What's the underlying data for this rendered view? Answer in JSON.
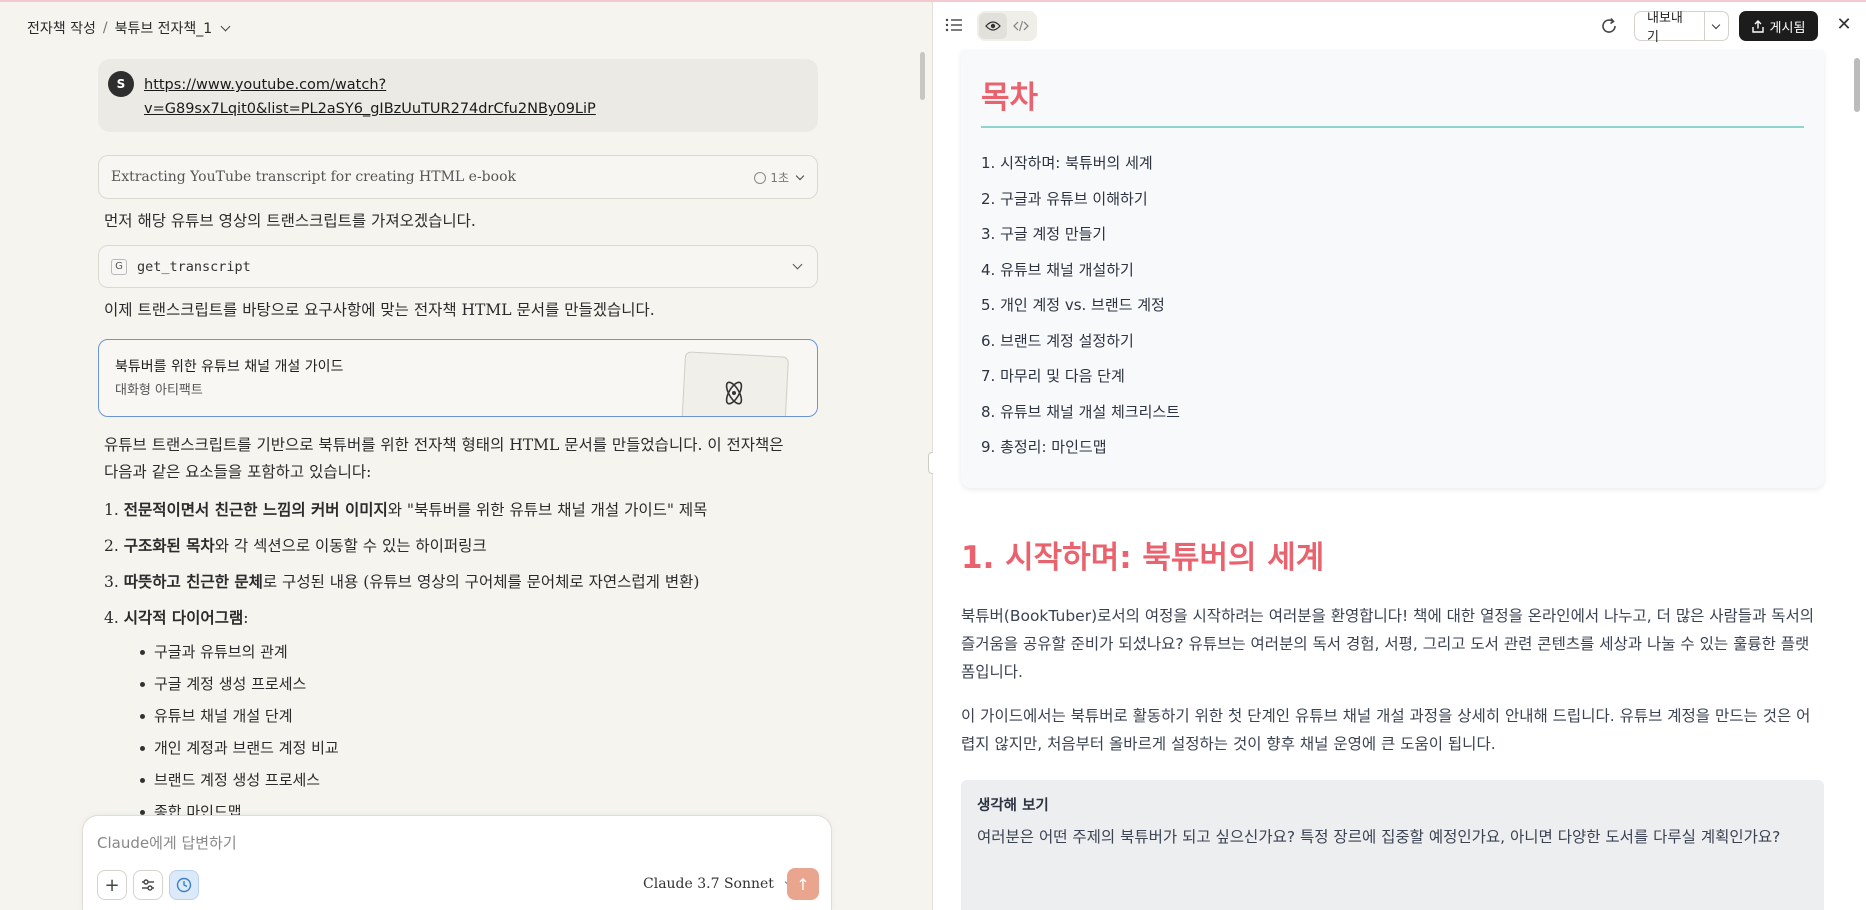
{
  "breadcrumb": {
    "project": "전자책 작성",
    "separator": "/",
    "chat": "북튜브 전자책_1"
  },
  "user_message": {
    "avatar": "S",
    "link_line1": "https://www.youtube.com/watch?",
    "link_line2": "v=G89sx7Lqit0&list=PL2aSY6_gIBzUuTUR274drCfu2NBy09LiP"
  },
  "thinking": {
    "text": "Extracting YouTube transcript for creating HTML e-book",
    "duration": "1초"
  },
  "assistant": {
    "para1": "먼저 해당 유튜브 영상의 트랜스크립트를 가져오겠습니다.",
    "tool_name": "get_transcript",
    "tool_icon": "G",
    "para2": "이제 트랜스크립트를 바탕으로 요구사항에 맞는 전자책 HTML 문서를 만들겠습니다.",
    "artifact_title": "북튜버를 위한 유튜브 채널 개설 가이드",
    "artifact_type": "대화형 아티팩트",
    "summary": "유튜브 트랜스크립트를 기반으로 북튜버를 위한 전자책 형태의 HTML 문서를 만들었습니다. 이 전자책은 다음과 같은 요소들을 포함하고 있습니다:",
    "items": [
      {
        "num": "1.",
        "bold": "전문적이면서 친근한 느낌의 커버 이미지",
        "rest": "와 \"북튜버를 위한 유튜브 채널 개설 가이드\" 제목"
      },
      {
        "num": "2.",
        "bold": "구조화된 목차",
        "rest": "와 각 섹션으로 이동할 수 있는 하이퍼링크"
      },
      {
        "num": "3.",
        "bold": "따뜻하고 친근한 문체",
        "rest": "로 구성된 내용 (유튜브 영상의 구어체를 문어체로 자연스럽게 변환)"
      },
      {
        "num": "4.",
        "bold": "시각적 다이어그램",
        "rest": ":"
      }
    ],
    "subitems": [
      "구글과 유튜브의 관계",
      "구글 계정 생성 프로세스",
      "유튜브 채널 개설 단계",
      "개인 계정과 브랜드 계정 비교",
      "브랜드 계정 생성 프로세스",
      "종합 마인드맵"
    ]
  },
  "composer": {
    "placeholder": "Claude에게 답변하기",
    "model": "Claude 3.7 Sonnet",
    "plus": "+",
    "send": "↑"
  },
  "toolbar": {
    "export_label": "내보내기",
    "publish_label": "게시됨",
    "close": "✕"
  },
  "doc": {
    "toc_title": "목차",
    "toc": [
      "1. 시작하며: 북튜버의 세계",
      "2. 구글과 유튜브 이해하기",
      "3. 구글 계정 만들기",
      "4. 유튜브 채널 개설하기",
      "5. 개인 계정 vs. 브랜드 계정",
      "6. 브랜드 계정 설정하기",
      "7. 마무리 및 다음 단계",
      "8. 유튜브 채널 개설 체크리스트",
      "9. 총정리: 마인드맵"
    ],
    "section1_title": "1. 시작하며: 북튜버의 세계",
    "section1_p1": "북튜버(BookTuber)로서의 여정을 시작하려는 여러분을 환영합니다! 책에 대한 열정을 온라인에서 나누고, 더 많은 사람들과 독서의 즐거움을 공유할 준비가 되셨나요? 유튜브는 여러분의 독서 경험, 서평, 그리고 도서 관련 콘텐츠를 세상과 나눌 수 있는 훌륭한 플랫폼입니다.",
    "section1_p2": "이 가이드에서는 북튜버로 활동하기 위한 첫 단계인 유튜브 채널 개설 과정을 상세히 안내해 드립니다. 유튜브 계정을 만드는 것은 어렵지 않지만, 처음부터 올바르게 설정하는 것이 향후 채널 운영에 큰 도움이 됩니다.",
    "callout_title": "생각해 보기",
    "callout_text": "여러분은 어떤 주제의 북튜버가 되고 싶으신가요? 특정 장르에 집중할 예정인가요, 아니면 다양한 도서를 다루실 계획인가요?"
  },
  "colors": {
    "heading": "#e9636f",
    "accent_line": "#8fd5cf",
    "publish_bg": "#1c1c1c",
    "send_bg": "#e9a58e",
    "artifact_border": "#6b95d6"
  }
}
